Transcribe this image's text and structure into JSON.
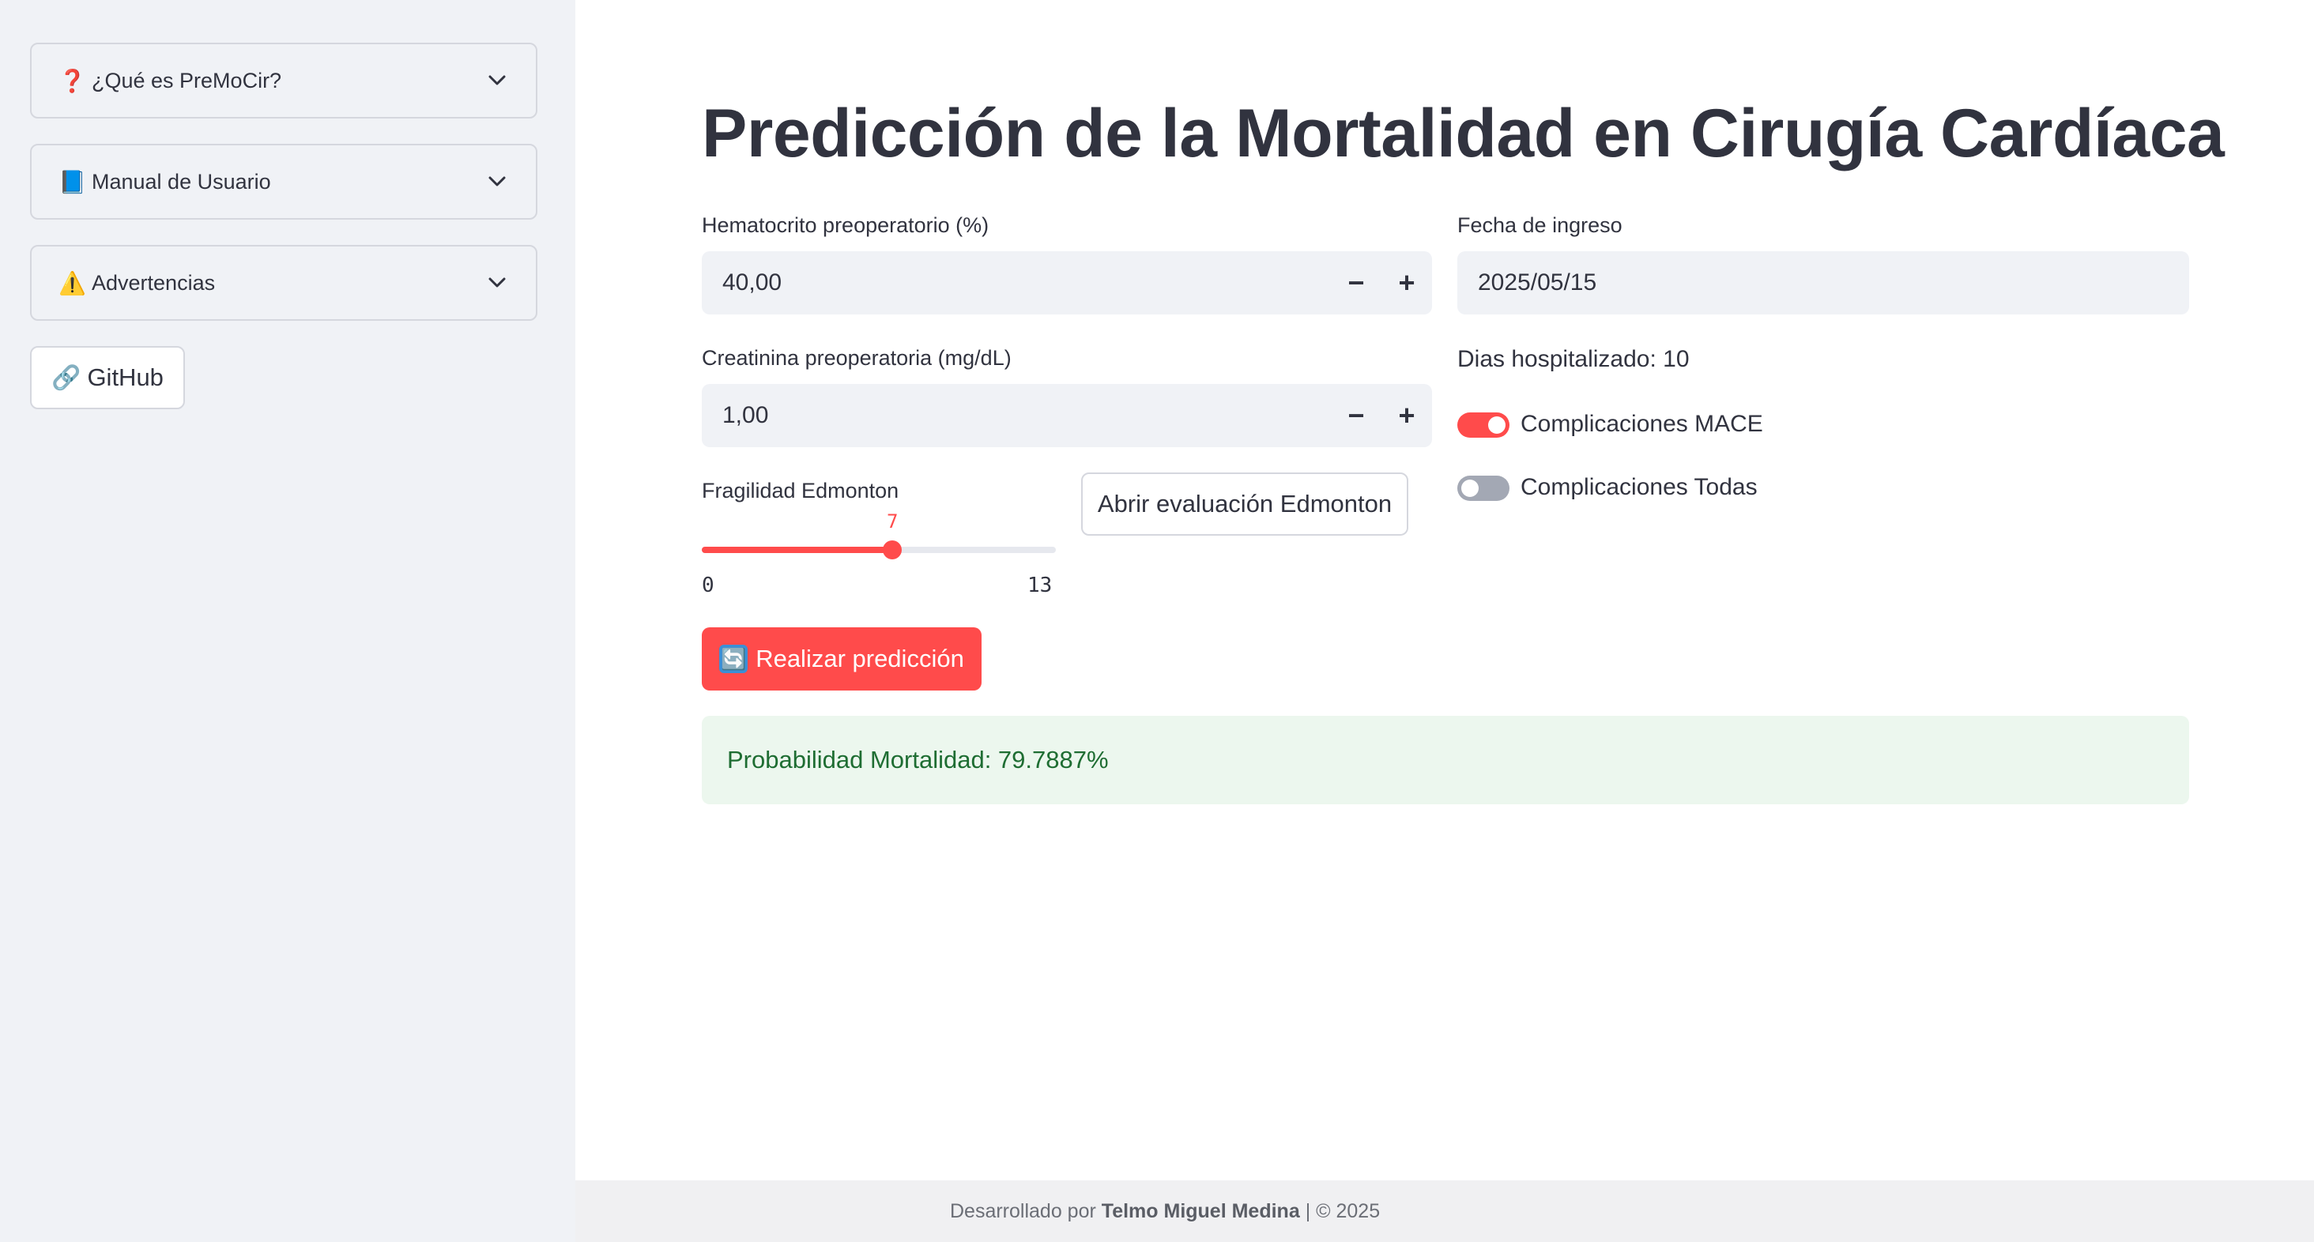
{
  "sidebar": {
    "expanders": [
      {
        "emoji": "❓",
        "label": "¿Qué es PreMoCir?"
      },
      {
        "emoji": "📘",
        "label": "Manual de Usuario"
      },
      {
        "emoji": "⚠️",
        "label": "Advertencias"
      }
    ],
    "github": {
      "emoji": "🔗",
      "label": "GitHub"
    }
  },
  "main": {
    "title": "Predicción de la Mortalidad en Cirugía Cardíaca",
    "hematocrito": {
      "label": "Hematocrito preoperatorio (%)",
      "value": "40,00",
      "minus": "−",
      "plus": "+"
    },
    "creatinina": {
      "label": "Creatinina preoperatoria (mg/dL)",
      "value": "1,00",
      "minus": "−",
      "plus": "+"
    },
    "fecha": {
      "label": "Fecha de ingreso",
      "value": "2025/05/15"
    },
    "dias_hospitalizado": "Dias hospitalizado: 10",
    "toggles": [
      {
        "label": "Complicaciones MACE",
        "on": true
      },
      {
        "label": "Complicaciones Todas",
        "on": false
      }
    ],
    "fragilidad": {
      "label": "Fragilidad Edmonton",
      "value": 7,
      "min": 0,
      "max": 13
    },
    "edmonton_button": "Abrir evaluación Edmonton",
    "predict_button": {
      "emoji": "🔄",
      "label": "Realizar predicción"
    },
    "result": "Probabilidad Mortalidad: 79.7887%"
  },
  "footer": {
    "prefix": "Desarrollado por",
    "author": "Telmo Miguel Medina",
    "suffix": "| © 2025"
  },
  "colors": {
    "accent": "#ff4b4b",
    "sidebar_bg": "#f0f2f6",
    "success_bg": "#ecf7ee",
    "success_text": "#1e6d32"
  }
}
